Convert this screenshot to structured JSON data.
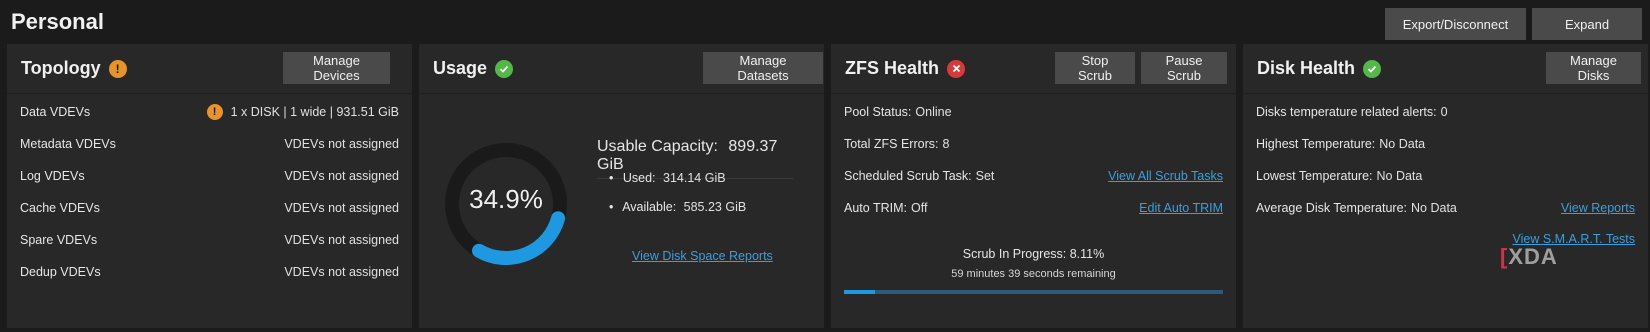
{
  "page": {
    "title": "Personal"
  },
  "toolbar": {
    "export_label": "Export/Disconnect",
    "expand_label": "Expand"
  },
  "topology": {
    "title": "Topology",
    "button": "Manage Devices",
    "rows": [
      {
        "label": "Data VDEVs",
        "value": "1 x DISK | 1 wide | 931.51 GiB",
        "warn": true
      },
      {
        "label": "Metadata VDEVs",
        "value": "VDEVs not assigned"
      },
      {
        "label": "Log VDEVs",
        "value": "VDEVs not assigned"
      },
      {
        "label": "Cache VDEVs",
        "value": "VDEVs not assigned"
      },
      {
        "label": "Spare VDEVs",
        "value": "VDEVs not assigned"
      },
      {
        "label": "Dedup VDEVs",
        "value": "VDEVs not assigned"
      }
    ]
  },
  "usage": {
    "title": "Usage",
    "button": "Manage Datasets",
    "percent_text": "34.9%",
    "percent": 34.9,
    "capacity_label": "Usable Capacity:",
    "capacity_value": "899.37 GiB",
    "used_label": "Used:",
    "used_value": "314.14 GiB",
    "available_label": "Available:",
    "available_value": "585.23 GiB",
    "report_link": "View Disk Space Reports"
  },
  "zfs": {
    "title": "ZFS Health",
    "stop_button": "Stop Scrub",
    "pause_button": "Pause Scrub",
    "pool_status_label": "Pool Status:",
    "pool_status_value": "Online",
    "errors_label": "Total ZFS Errors:",
    "errors_value": "8",
    "scrub_task_label": "Scheduled Scrub Task:",
    "scrub_task_value": "Set",
    "scrub_task_link": "View All Scrub Tasks",
    "trim_label": "Auto TRIM:",
    "trim_value": "Off",
    "trim_link": "Edit Auto TRIM",
    "progress_label": "Scrub In Progress:",
    "progress_value": "8.11%",
    "progress_fraction": 0.0811,
    "remaining": "59 minutes 39 seconds remaining"
  },
  "disk": {
    "title": "Disk Health",
    "button": "Manage Disks",
    "alerts_label": "Disks temperature related alerts:",
    "alerts_value": "0",
    "highest_label": "Highest Temperature:",
    "highest_value": "No Data",
    "lowest_label": "Lowest Temperature:",
    "lowest_value": "No Data",
    "average_label": "Average Disk Temperature:",
    "average_value": "No Data",
    "reports_link": "View Reports",
    "smart_link": "View S.M.A.R.T. Tests"
  },
  "watermark": {
    "text": "XDA"
  },
  "colors": {
    "accent": "#1e98e0",
    "ok": "#52b848",
    "warn": "#e8942a",
    "error": "#d83a3a",
    "card": "#282828",
    "background": "#1b1b1b"
  },
  "icons": {
    "warn": "exclamation-circle-icon",
    "ok": "check-circle-icon",
    "error": "x-circle-icon"
  }
}
